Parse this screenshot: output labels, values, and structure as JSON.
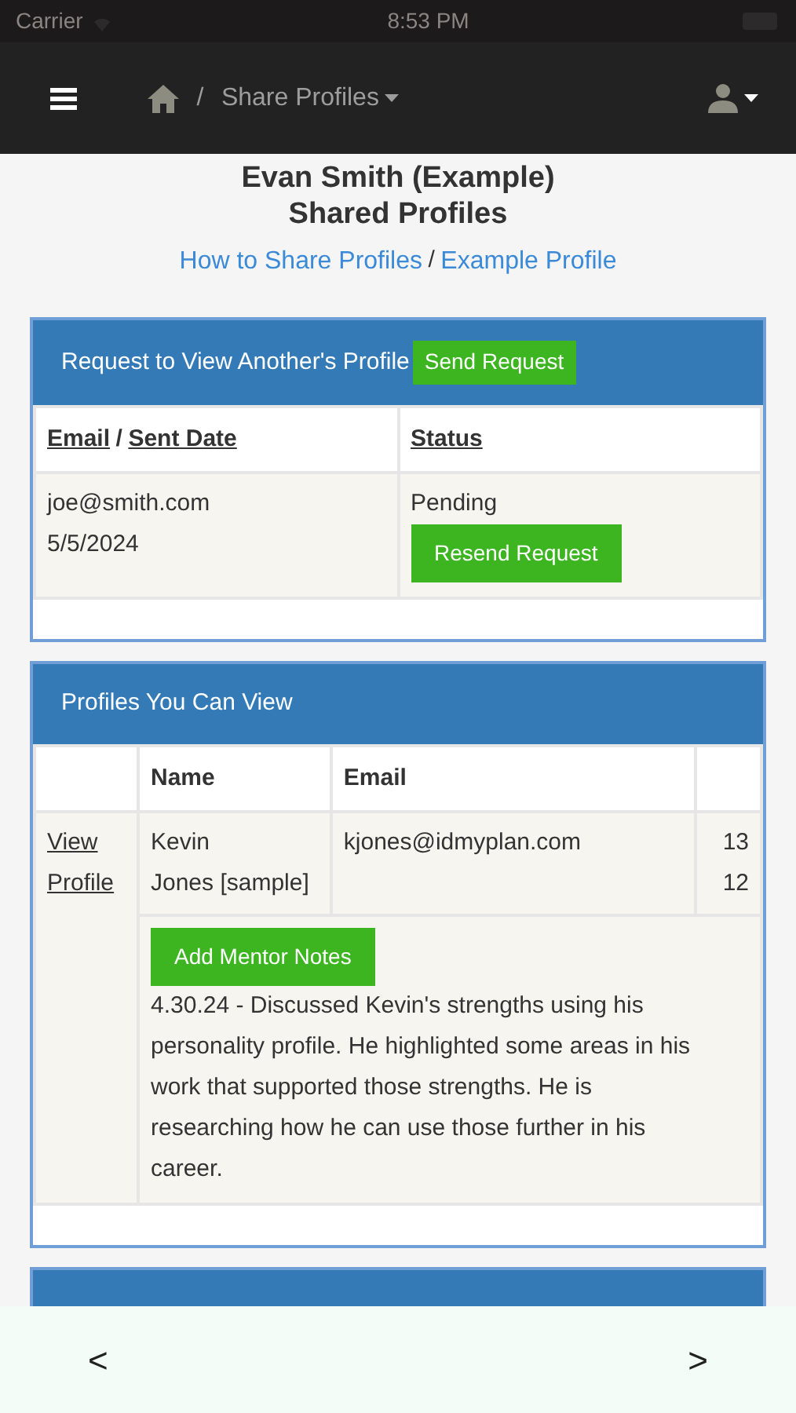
{
  "status_bar": {
    "carrier": "Carrier",
    "time": "8:53 PM"
  },
  "navbar": {
    "current": "Share Profiles",
    "separator": "/"
  },
  "header": {
    "title_lines": [
      "Evan Smith (Example)",
      "Shared Profiles"
    ],
    "links": [
      "How to Share Profiles",
      "Example Profile"
    ],
    "separator": "/"
  },
  "requests_panel": {
    "title": "Request to View Another's Profile",
    "button": "Send Request",
    "columns": [
      {
        "parts": [
          "Email",
          "Sent Date"
        ],
        "separator": "/"
      },
      {
        "parts": [
          "Status"
        ]
      }
    ],
    "rows": [
      {
        "email": "joe@smith.com",
        "date": "5/5/2024",
        "status": "Pending",
        "button": "Resend Request"
      }
    ]
  },
  "profiles_panel": {
    "title": "Profiles You Can View",
    "columns": [
      "Name",
      "Email"
    ],
    "rows": [
      {
        "link_lines": [
          "View",
          "Profile"
        ],
        "name_lines": [
          "Kevin",
          "Jones [sample]"
        ],
        "email": "kjones@idmyplan.com",
        "column_4_lines": [
          "13",
          "12"
        ],
        "notes_button": "Add Mentor Notes",
        "note": "4.30.24 - Discussed Kevin's strengths using his personality profile. He highlighted some areas in his work that supported those strengths. He is researching how he can use those further in his career."
      }
    ]
  },
  "bottom_bar": {
    "back": "<",
    "forward": ">"
  }
}
